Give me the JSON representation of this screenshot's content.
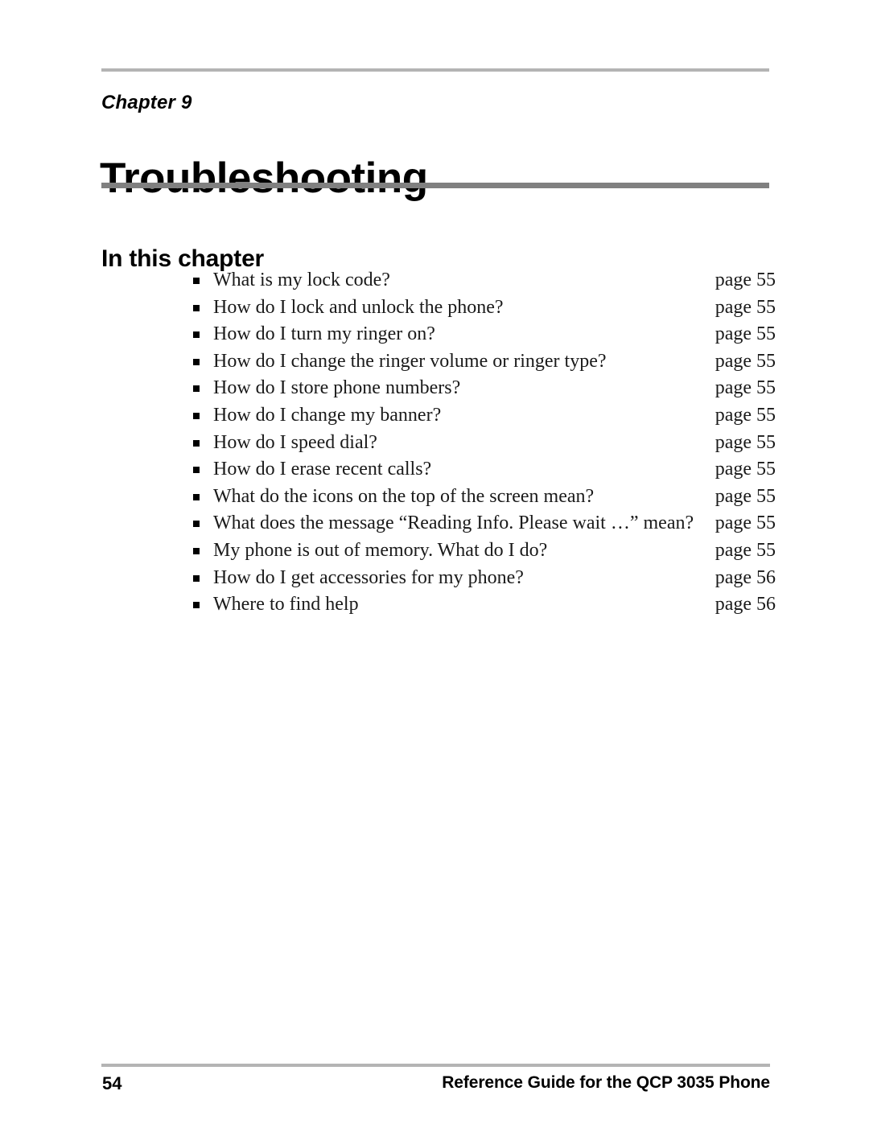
{
  "header": {
    "chapter_label": "Chapter 9",
    "chapter_title": "Troubleshooting",
    "rule_color_light": "#b4b4b4",
    "rule_color_dark": "#808080"
  },
  "section": {
    "heading": "In this chapter"
  },
  "toc": {
    "items": [
      {
        "label": "What is my lock code?",
        "page": "page 55"
      },
      {
        "label": "How do I lock and unlock the phone?",
        "page": "page 55"
      },
      {
        "label": "How do I turn my ringer on?",
        "page": "page 55"
      },
      {
        "label": "How do I change the ringer volume or ringer type?",
        "page": "page 55"
      },
      {
        "label": "How do I store phone numbers?",
        "page": "page 55"
      },
      {
        "label": "How do I change my banner?",
        "page": "page 55"
      },
      {
        "label": "How do I speed dial?",
        "page": "page 55"
      },
      {
        "label": "How do I erase recent calls?",
        "page": "page 55"
      },
      {
        "label": "What do the icons on the top of the screen mean?",
        "page": "page 55"
      },
      {
        "label": "What does the message “Reading Info. Please wait …” mean?",
        "page": "page 55"
      },
      {
        "label": "My phone is out of memory. What do I do?",
        "page": "page 55"
      },
      {
        "label": "How do I get accessories for my phone?",
        "page": "page 56"
      },
      {
        "label": "Where to find help",
        "page": "page 56"
      }
    ]
  },
  "footer": {
    "page_number": "54",
    "guide_text": "Reference Guide for the QCP 3035 Phone"
  }
}
